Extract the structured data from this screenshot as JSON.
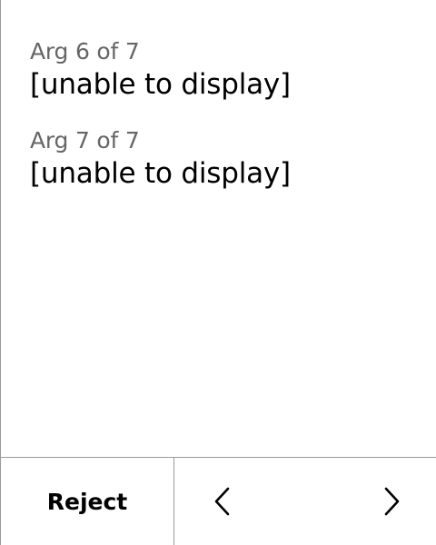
{
  "args": [
    {
      "label": "Arg 6 of 7",
      "value": "[unable to display]"
    },
    {
      "label": "Arg 7 of 7",
      "value": "[unable to display]"
    }
  ],
  "footer": {
    "reject_label": "Reject",
    "prev_icon": "chevron-left-icon",
    "next_icon": "chevron-right-icon"
  },
  "colors": {
    "background": "#ffffff",
    "text": "#000000",
    "label": "#666666",
    "divider": "#9a9a9a"
  }
}
